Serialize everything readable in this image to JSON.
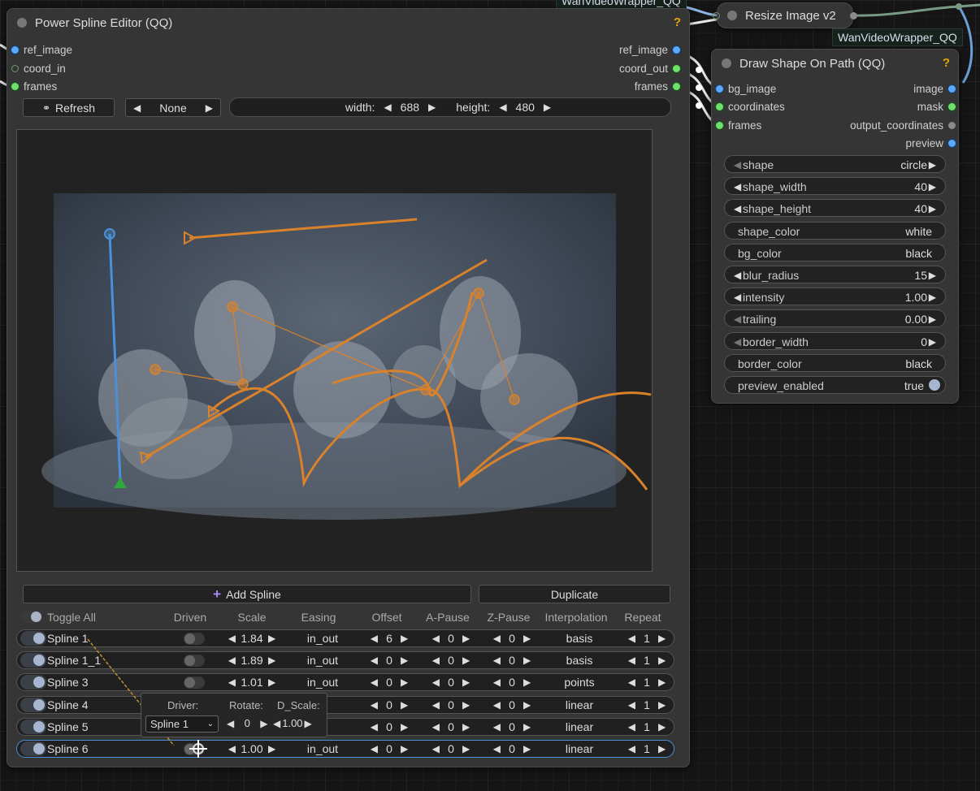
{
  "colors": {
    "spline_orange": "#d9822b",
    "spline_blue": "#4a90d9",
    "start_green": "#2eaa3c",
    "help_yellow": "#e5a50a"
  },
  "top_tag": "WanVideoWrapper_QQ",
  "resize_node": {
    "title": "Resize Image v2",
    "tag": "WanVideoWrapper_QQ"
  },
  "spline_editor": {
    "title": "Power Spline Editor (QQ)",
    "help": "?",
    "inputs": [
      "ref_image",
      "coord_in",
      "frames"
    ],
    "outputs": [
      "ref_image",
      "coord_out",
      "frames"
    ],
    "refresh_label": "Refresh",
    "refresh_icon": "refresh-icon",
    "bg_select": "None",
    "width_label": "width:",
    "width_value": "688",
    "height_label": "height:",
    "height_value": "480",
    "add_spline_label": "Add Spline",
    "duplicate_label": "Duplicate",
    "headers": {
      "toggle_all": "Toggle All",
      "driven": "Driven",
      "scale": "Scale",
      "easing": "Easing",
      "offset": "Offset",
      "a_pause": "A-Pause",
      "z_pause": "Z-Pause",
      "interpolation": "Interpolation",
      "repeat": "Repeat"
    },
    "splines": [
      {
        "name": "Spline 1",
        "driven": false,
        "scale": "1.84",
        "easing": "in_out",
        "offset": "6",
        "a_pause": "0",
        "z_pause": "0",
        "interpolation": "basis",
        "repeat": "1"
      },
      {
        "name": "Spline 1_1",
        "driven": false,
        "scale": "1.89",
        "easing": "in_out",
        "offset": "0",
        "a_pause": "0",
        "z_pause": "0",
        "interpolation": "basis",
        "repeat": "1"
      },
      {
        "name": "Spline 3",
        "driven": false,
        "scale": "1.01",
        "easing": "in_out",
        "offset": "0",
        "a_pause": "0",
        "z_pause": "0",
        "interpolation": "points",
        "repeat": "1"
      },
      {
        "name": "Spline 4",
        "driven": false,
        "scale": "",
        "easing": "ut",
        "offset": "0",
        "a_pause": "0",
        "z_pause": "0",
        "interpolation": "linear",
        "repeat": "1"
      },
      {
        "name": "Spline 5",
        "driven": false,
        "scale": "",
        "easing": "ut",
        "offset": "0",
        "a_pause": "0",
        "z_pause": "0",
        "interpolation": "linear",
        "repeat": "1"
      },
      {
        "name": "Spline 6",
        "driven": true,
        "scale": "1.00",
        "easing": "in_out",
        "offset": "0",
        "a_pause": "0",
        "z_pause": "0",
        "interpolation": "linear",
        "repeat": "1"
      }
    ],
    "driver_popup": {
      "driver_label": "Driver:",
      "rotate_label": "Rotate:",
      "dscale_label": "D_Scale:",
      "driver_value": "Spline 1",
      "rotate_value": "0",
      "dscale_value": "1.00"
    }
  },
  "draw_shape": {
    "title": "Draw Shape On Path (QQ)",
    "help": "?",
    "inputs": [
      "bg_image",
      "coordinates",
      "frames"
    ],
    "outputs": [
      "image",
      "mask",
      "output_coordinates",
      "preview"
    ],
    "widgets": [
      {
        "label": "shape",
        "value": "circle",
        "arrows": true
      },
      {
        "label": "shape_width",
        "value": "40",
        "arrows": true
      },
      {
        "label": "shape_height",
        "value": "40",
        "arrows": true
      },
      {
        "label": "shape_color",
        "value": "white",
        "arrows": false
      },
      {
        "label": "bg_color",
        "value": "black",
        "arrows": false
      },
      {
        "label": "blur_radius",
        "value": "15",
        "arrows": true
      },
      {
        "label": "intensity",
        "value": "1.00",
        "arrows": true
      },
      {
        "label": "trailing",
        "value": "0.00",
        "arrows": true
      },
      {
        "label": "border_width",
        "value": "0",
        "arrows": true
      },
      {
        "label": "border_color",
        "value": "black",
        "arrows": false
      },
      {
        "label": "preview_enabled",
        "value": "true",
        "arrows": false
      }
    ]
  }
}
